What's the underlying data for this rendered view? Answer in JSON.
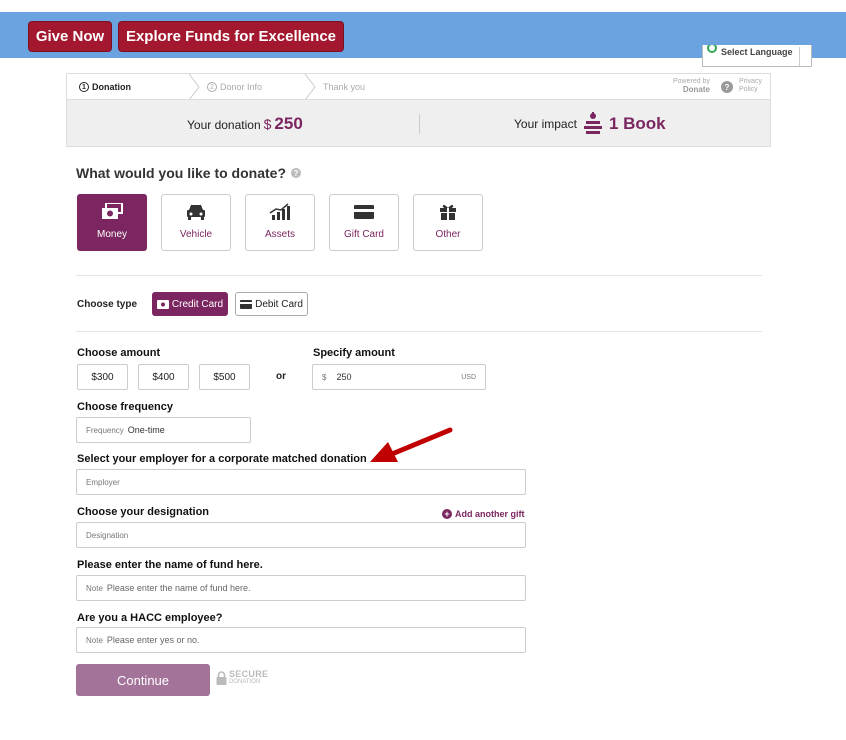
{
  "header": {
    "give_now": "Give Now",
    "explore_funds": "Explore Funds for Excellence",
    "language_label": "Select Language"
  },
  "steps": {
    "donation": "Donation",
    "donor_info": "Donor Info",
    "thank_you": "Thank you",
    "donation_num": "1",
    "donor_info_num": "2",
    "powered_by": "Powered by",
    "donate_brand": "Donate",
    "privacy_policy_1": "Privacy",
    "privacy_policy_2": "Policy"
  },
  "summary": {
    "your_donation": "Your donation",
    "currency": "$",
    "amount": "250",
    "your_impact": "Your impact",
    "impact_value": "1 Book"
  },
  "question": "What would you like to donate?",
  "donation_types": [
    {
      "label": "Money",
      "icon": "money-icon",
      "active": true
    },
    {
      "label": "Vehicle",
      "icon": "car-icon",
      "active": false
    },
    {
      "label": "Assets",
      "icon": "chart-icon",
      "active": false
    },
    {
      "label": "Gift Card",
      "icon": "card-icon",
      "active": false
    },
    {
      "label": "Other",
      "icon": "gift-icon",
      "active": false
    }
  ],
  "payment": {
    "choose_type": "Choose type",
    "credit_card": "Credit Card",
    "debit_card": "Debit Card"
  },
  "amount": {
    "choose_amount": "Choose amount",
    "options": [
      "$300",
      "$400",
      "$500"
    ],
    "or": "or",
    "specify_amount": "Specify amount",
    "currency_symbol": "$",
    "value": "250",
    "currency_code": "USD"
  },
  "frequency": {
    "label": "Choose frequency",
    "field_label": "Frequency",
    "value": "One-time"
  },
  "employer": {
    "label": "Select your employer for a corporate matched donation",
    "placeholder": "Employer"
  },
  "designation": {
    "label": "Choose your designation",
    "add_gift": "Add another gift",
    "placeholder": "Designation"
  },
  "fund_name": {
    "label": "Please enter the name of fund here.",
    "field_label": "Note",
    "placeholder": "Please enter the name of fund here."
  },
  "hacc": {
    "label": "Are you a HACC employee?",
    "field_label": "Note",
    "placeholder": "Please enter yes or no."
  },
  "footer": {
    "continue": "Continue",
    "secure_1": "SECURE",
    "secure_2": "DONATION"
  },
  "colors": {
    "brand_purple": "#7b2660",
    "header_blue": "#6aa3df",
    "button_red": "#a3182f",
    "arrow_red": "#c00000"
  }
}
